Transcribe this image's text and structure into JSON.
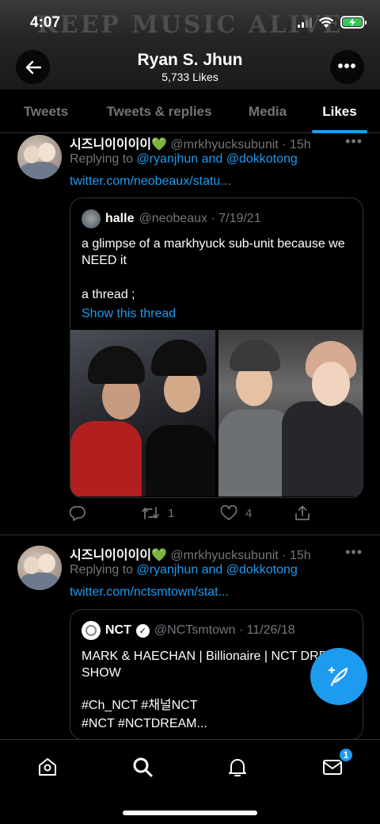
{
  "status_bar": {
    "time": "4:07"
  },
  "banner": {
    "text": "KEEP MUSIC ALIVE"
  },
  "header": {
    "name": "Ryan S. Jhun",
    "likes": "5,733 Likes",
    "more": "•••"
  },
  "tabs": [
    {
      "label": "Tweets"
    },
    {
      "label": "Tweets & replies"
    },
    {
      "label": "Media"
    },
    {
      "label": "Likes"
    }
  ],
  "tweets": [
    {
      "name": "시즈니이이이이",
      "handle": "@mrkhyucksubunit · 15h",
      "more": "•••",
      "replying_prefix": "Replying to ",
      "replying_to": "@ryanjhun and @dokkotong",
      "url": "twitter.com/neobeaux/statu...",
      "quote": {
        "name": "halle",
        "handle": "@neobeaux · 7/19/21",
        "text1": "a glimpse of a markhyuck sub-unit because we NEED it",
        "text2": "a thread ;",
        "show_thread": "Show this thread"
      },
      "retweets": "1",
      "likes": "4"
    },
    {
      "name": "시즈니이이이이",
      "handle": "@mrkhyucksubunit · 15h",
      "more": "•••",
      "replying_prefix": "Replying to ",
      "replying_to": "@ryanjhun and @dokkotong",
      "url": "twitter.com/nctsmtown/stat...",
      "quote": {
        "name": "NCT",
        "verified": "✓",
        "handle": "@NCTsmtown · 11/26/18",
        "text1": "MARK & HAECHAN | Billionaire | NCT DREAM SHOW",
        "text2": "#Ch_NCT #채널NCT",
        "text3": "#NCT #NCTDREAM..."
      }
    }
  ],
  "bottom_nav": {
    "messages_badge": "1"
  },
  "colors": {
    "accent": "#1d9bf0",
    "background": "#000000",
    "muted": "#71767b",
    "heart_emoji": "#5ac84f"
  }
}
